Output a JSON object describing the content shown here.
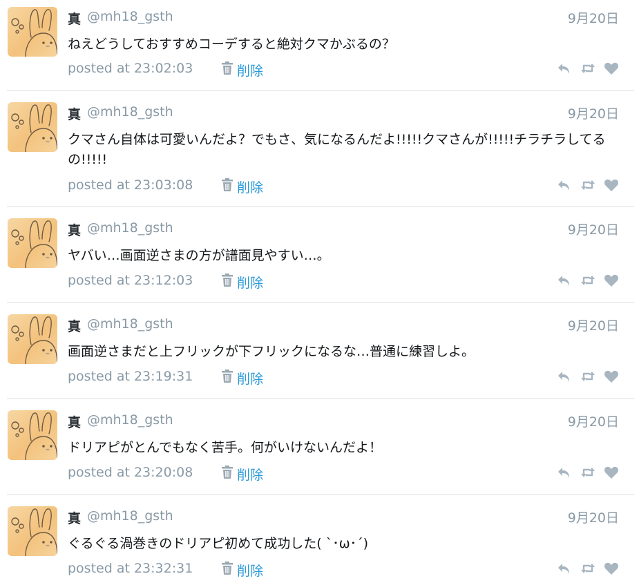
{
  "colors": {
    "name": "#292f33",
    "muted": "#8899a6",
    "link": "#2b9bd7",
    "icon": "#a8b6c1",
    "separator": "#dedede"
  },
  "icons": {
    "avatar": "rabbit-avatar",
    "delete": "trash-icon",
    "reply": "reply-icon",
    "retweet": "retweet-icon",
    "like": "heart-icon"
  },
  "tweets": [
    {
      "name": "真",
      "handle": "@mh18_gsth",
      "date": "9月20日",
      "text": "ねえどうしておすすめコーデすると絶対クマかぶるの？",
      "posted": "posted at 23:02:03",
      "delete_label": "削除"
    },
    {
      "name": "真",
      "handle": "@mh18_gsth",
      "date": "9月20日",
      "text": "クマさん自体は可愛いんだよ？でもさ、気になるんだよ!!!!!クマさんが!!!!!チラチラしてるの!!!!!",
      "posted": "posted at 23:03:08",
      "delete_label": "削除"
    },
    {
      "name": "真",
      "handle": "@mh18_gsth",
      "date": "9月20日",
      "text": "ヤバい…画面逆さまの方が譜面見やすい…。",
      "posted": "posted at 23:12:03",
      "delete_label": "削除"
    },
    {
      "name": "真",
      "handle": "@mh18_gsth",
      "date": "9月20日",
      "text": "画面逆さまだと上フリックが下フリックになるな…普通に練習しよ。",
      "posted": "posted at 23:19:31",
      "delete_label": "削除"
    },
    {
      "name": "真",
      "handle": "@mh18_gsth",
      "date": "9月20日",
      "text": "ドリアピがとんでもなく苦手。何がいけないんだよ！",
      "posted": "posted at 23:20:08",
      "delete_label": "削除"
    },
    {
      "name": "真",
      "handle": "@mh18_gsth",
      "date": "9月20日",
      "text": "ぐるぐる渦巻きのドリアピ初めて成功した( ˋ･ω･ˊ)",
      "posted": "posted at 23:32:31",
      "delete_label": "削除"
    }
  ]
}
